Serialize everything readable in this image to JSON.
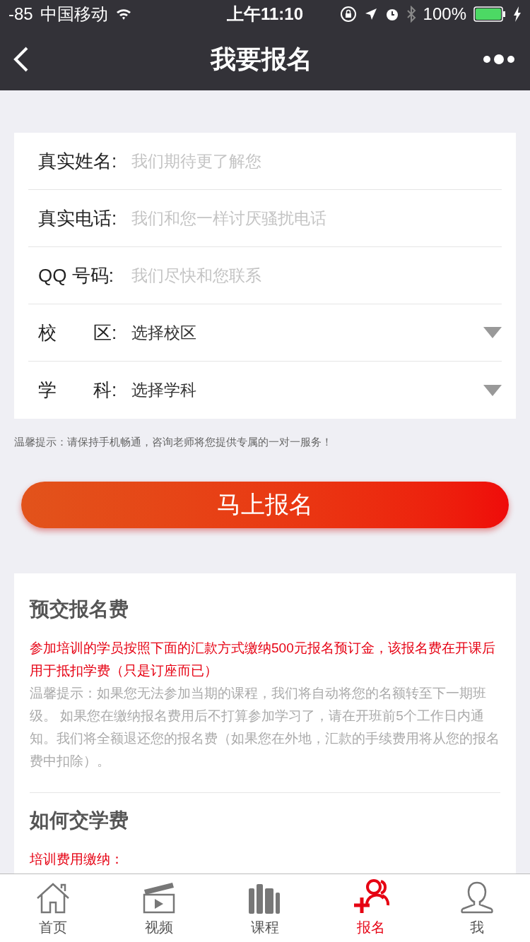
{
  "status_bar": {
    "signal": "-85",
    "carrier": "中国移动",
    "time": "上午11:10",
    "battery": "100%"
  },
  "nav": {
    "title": "我要报名"
  },
  "form": {
    "fields": [
      {
        "kind": "text",
        "label": "真实姓名:",
        "placeholder": "我们期待更了解您"
      },
      {
        "kind": "text",
        "label": "真实电话:",
        "placeholder": "我们和您一样讨厌骚扰电话"
      },
      {
        "kind": "text",
        "label": "QQ 号码:",
        "placeholder": "我们尽快和您联系"
      },
      {
        "kind": "select",
        "label": "校　　区:",
        "value": "选择校区"
      },
      {
        "kind": "select",
        "label": "学　　科:",
        "value": "选择学科"
      }
    ],
    "tip": "温馨提示：请保持手机畅通，咨询老师将您提供专属的一对一服务！"
  },
  "submit_button": "马上报名",
  "info": {
    "sections": [
      {
        "title": "预交报名费",
        "paragraphs": [
          {
            "kind": "highlight",
            "text": "参加培训的学员按照下面的汇款方式缴纳500元报名预订金，该报名费在开课后用于抵扣学费（只是订座而已）"
          },
          {
            "kind": "note",
            "text": "温馨提示：如果您无法参加当期的课程，我们将自动将您的名额转至下一期班级。 如果您在缴纳报名费用后不打算参加学习了，请在开班前5个工作日内通知。我们将全额退还您的报名费（如果您在外地，汇款的手续费用将从您的报名费中扣除）。"
          }
        ]
      },
      {
        "title": "如何交学费",
        "paragraphs": [
          {
            "kind": "highlight",
            "text": "培训费用缴纳："
          }
        ]
      }
    ]
  },
  "tab_bar": [
    {
      "kind": "home",
      "label": "首页",
      "selected": false
    },
    {
      "kind": "video",
      "label": "视频",
      "selected": false
    },
    {
      "kind": "books",
      "label": "课程",
      "selected": false
    },
    {
      "kind": "signup",
      "label": "报名",
      "selected": true
    },
    {
      "kind": "user",
      "label": "我",
      "selected": false
    }
  ]
}
